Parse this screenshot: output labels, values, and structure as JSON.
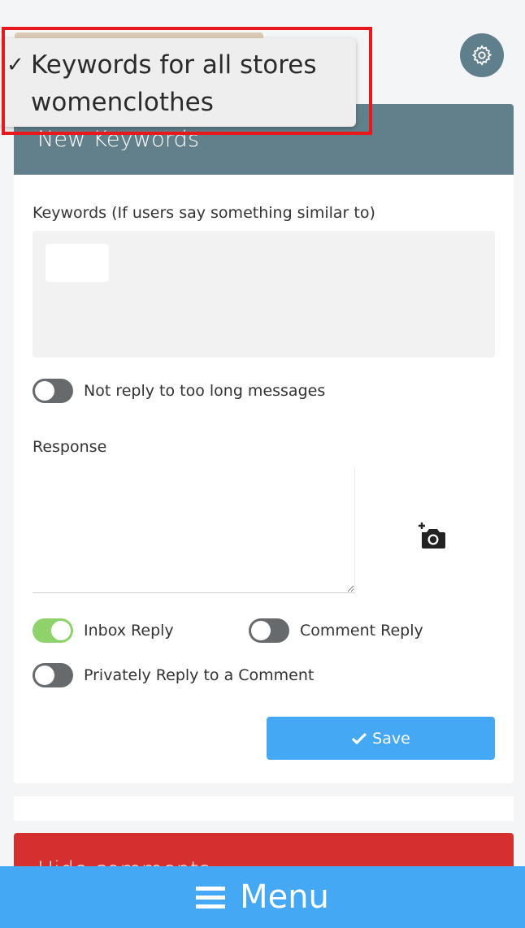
{
  "dropdown": {
    "options": [
      {
        "label": "Keywords for all stores",
        "checked": true
      },
      {
        "label": "womenclothes",
        "checked": false
      }
    ],
    "check_glyph": "✓"
  },
  "settings": {
    "icon": "gear-icon"
  },
  "card": {
    "title": "New Keywords",
    "keywords_label": "Keywords (If users say something similar to)",
    "not_reply_label": "Not reply to too long messages",
    "not_reply_on": false,
    "response_label": "Response",
    "response_value": "",
    "camera_icon": "add-photo-icon",
    "inbox_reply_label": "Inbox Reply",
    "inbox_reply_on": true,
    "comment_reply_label": "Comment Reply",
    "comment_reply_on": false,
    "private_reply_label": "Privately Reply to a Comment",
    "private_reply_on": false,
    "save_label": "Save"
  },
  "hide_card": {
    "title": "Hide comments"
  },
  "menu": {
    "label": "Menu",
    "icon": "hamburger-icon"
  },
  "colors": {
    "header": "#627f8c",
    "accent": "#45a8f5",
    "toggle_on": "#8fd16b",
    "toggle_off": "#666a6d",
    "danger": "#d5302f",
    "highlight": "#e8191c"
  }
}
